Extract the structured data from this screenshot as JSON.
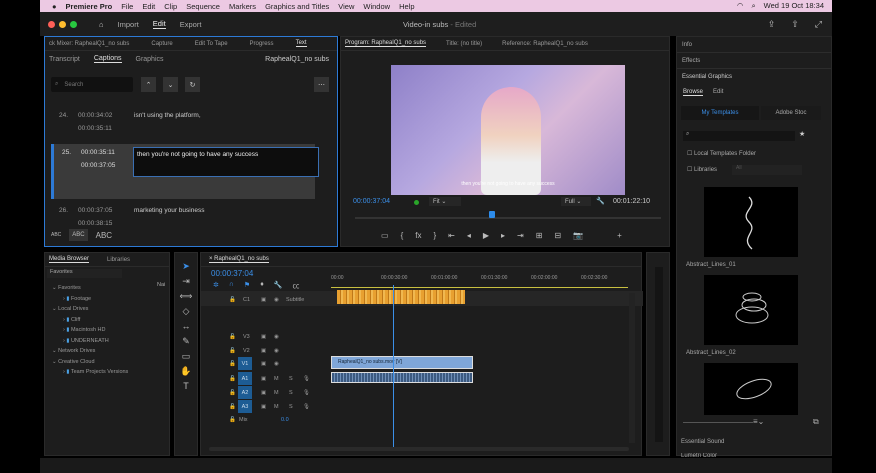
{
  "menubar": {
    "app": "Premiere Pro",
    "items": [
      "File",
      "Edit",
      "Clip",
      "Sequence",
      "Markers",
      "Graphics and Titles",
      "View",
      "Window",
      "Help"
    ],
    "clock": "Wed 19 Oct  18:34"
  },
  "titlebar": {
    "nav": [
      "Import",
      "Edit",
      "Export"
    ],
    "title": "Video-in subs",
    "status": " - Edited"
  },
  "text_panel": {
    "tabs": [
      "ck Mixer: RaphealQ1_no subs",
      "Capture",
      "Edit To Tape",
      "Progress",
      "Text"
    ],
    "subtabs": [
      "Transcript",
      "Captions",
      "Graphics"
    ],
    "sequence": "RaphealQ1_no subs",
    "search_placeholder": "Search",
    "captions": [
      {
        "n": "24.",
        "start": "00:00:34:02",
        "end": "00:00:35:11",
        "text": "isn't using the platform,"
      },
      {
        "n": "25.",
        "start": "00:00:35:11",
        "end": "00:00:37:05",
        "text": "then you're not going to have any success"
      },
      {
        "n": "26.",
        "start": "00:00:37:05",
        "end": "00:00:38:15",
        "text": "marketing your business"
      }
    ],
    "case_buttons": [
      "ABC",
      "ABC",
      "ABC"
    ]
  },
  "program": {
    "tabs": [
      "Program: RaphealQ1_no subs",
      "Title: (no title)",
      "Reference: RaphealQ1_no subs"
    ],
    "timecode": "00:00:37:04",
    "fit": "Fit",
    "quality": "Full",
    "duration": "00:01:22:10",
    "overlay_caption": "then you're not going to have any success"
  },
  "media_browser": {
    "tabs": [
      "Media Browser",
      "Libraries"
    ],
    "dropdown": "Favorites",
    "col": "Nai",
    "tree": [
      {
        "label": "Favorites",
        "lvl": 0
      },
      {
        "label": "Footage",
        "lvl": 1
      },
      {
        "label": "Local Drives",
        "lvl": 0
      },
      {
        "label": "Cliff",
        "lvl": 1
      },
      {
        "label": "Macintosh HD",
        "lvl": 1
      },
      {
        "label": "UNDERNEATH",
        "lvl": 1
      },
      {
        "label": "Network Drives",
        "lvl": 0
      },
      {
        "label": "Creative Cloud",
        "lvl": 0
      },
      {
        "label": "Team Projects Versions",
        "lvl": 1
      }
    ]
  },
  "timeline": {
    "sequence": "RaphealQ1_no subs",
    "timecode": "00:00:37:04",
    "ruler": [
      "00:00",
      "00:00:30:00",
      "00:01:00:00",
      "00:01:30:00",
      "00:02:00:00",
      "00:02:30:00"
    ],
    "tracks": {
      "c1": "C1",
      "subtitle": "Subtitle",
      "v3": "V3",
      "v2": "V2",
      "v1": "V1",
      "a1": "A1",
      "a2": "A2",
      "a3": "A3",
      "m": "M",
      "s": "S",
      "mix": "Mix",
      "mix_val": "0.0"
    },
    "video_clip": "RaphealQ1_no subs.mov [V]",
    "playhead_fraction": 0.24
  },
  "right_panel": {
    "sections": [
      "Info",
      "Effects",
      "Essential Graphics"
    ],
    "tabs": [
      "Browse",
      "Edit"
    ],
    "template_tabs": [
      "My Templates",
      "Adobe Stoc"
    ],
    "local_folder": "Local Templates Folder",
    "libraries": "Libraries",
    "libraries_val": "All",
    "templates": [
      "Abstract_Lines_01",
      "Abstract_Lines_02"
    ],
    "bottom": [
      "Essential Sound",
      "Lumetri Color"
    ]
  },
  "colors": {
    "accent": "#2d8ceb",
    "menubar": "#ecc9e3",
    "caption_clip": "#e8a030",
    "video_clip": "#7fa6d8"
  }
}
